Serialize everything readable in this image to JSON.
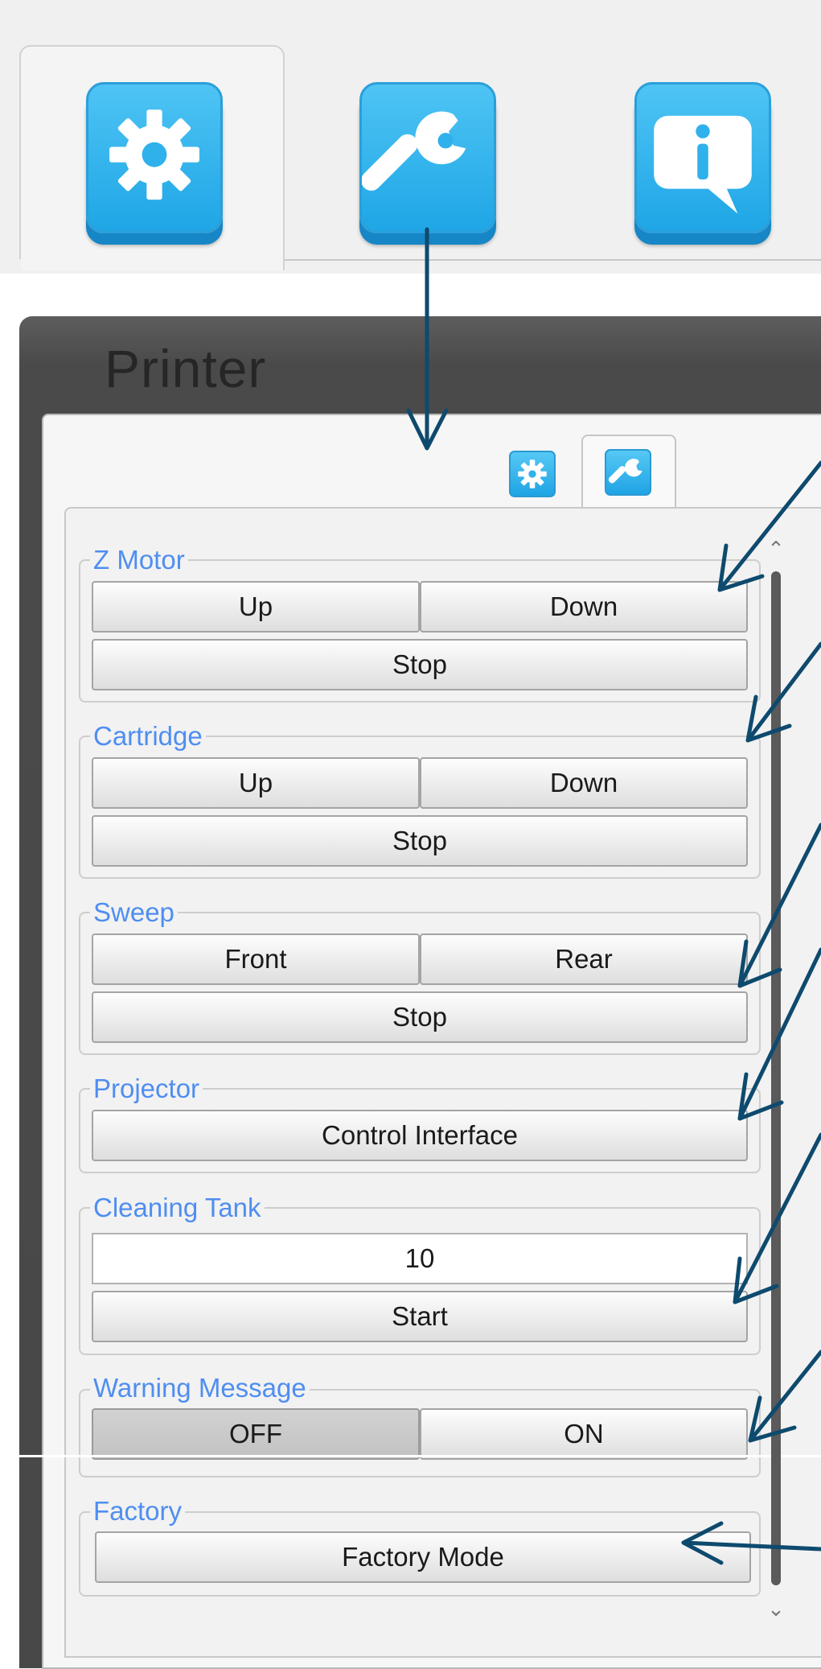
{
  "top_tabs": [
    {
      "name": "settings",
      "icon": "gear-icon",
      "active": true
    },
    {
      "name": "tools",
      "icon": "wrench-icon",
      "active": false
    },
    {
      "name": "info",
      "icon": "info-icon",
      "active": false
    }
  ],
  "window": {
    "title": "Printer"
  },
  "small_tabs": [
    {
      "icon": "gear-icon",
      "active": false
    },
    {
      "icon": "wrench-icon",
      "active": true
    }
  ],
  "groups": {
    "z_motor": {
      "title": "Z Motor",
      "up": "Up",
      "down": "Down",
      "stop": "Stop"
    },
    "cartridge": {
      "title": "Cartridge",
      "up": "Up",
      "down": "Down",
      "stop": "Stop"
    },
    "sweep": {
      "title": "Sweep",
      "front": "Front",
      "rear": "Rear",
      "stop": "Stop"
    },
    "projector": {
      "title": "Projector",
      "control": "Control Interface"
    },
    "cleaning_tank": {
      "title": "Cleaning Tank",
      "value": "10",
      "start": "Start"
    },
    "warning_message": {
      "title": "Warning Message",
      "off": "OFF",
      "on": "ON",
      "selected": "OFF"
    },
    "factory": {
      "title": "Factory",
      "mode": "Factory Mode"
    }
  },
  "colors": {
    "accent_blue": "#1fa6e6",
    "group_title": "#4f8ef0",
    "arrow": "#0e4a6e",
    "window_frame": "#4a4a4a"
  }
}
